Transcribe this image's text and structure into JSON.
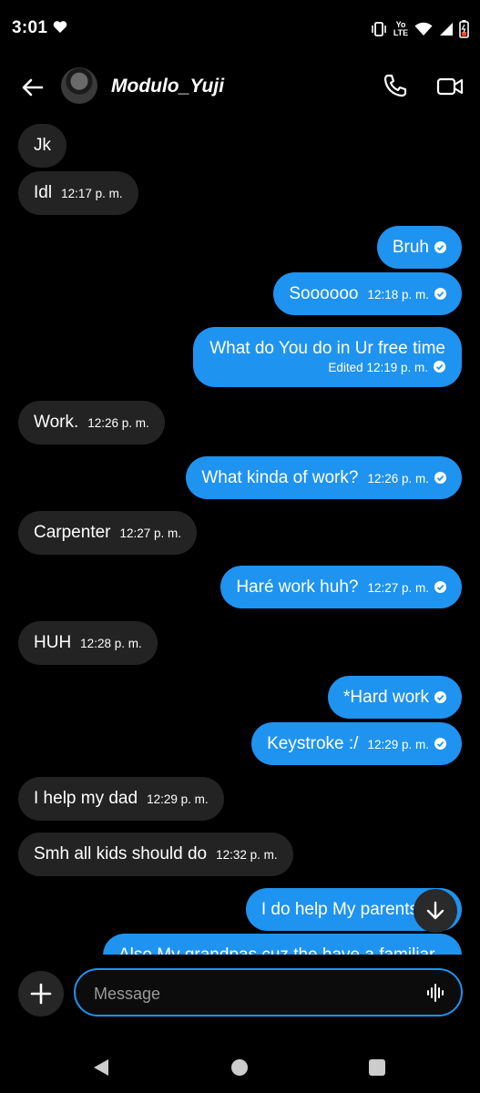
{
  "status_bar": {
    "time": "3:01",
    "network": "LTE",
    "carrier_badge": "Yo"
  },
  "header": {
    "contact_name": "Modulo_Yuji"
  },
  "messages": [
    {
      "side": "in",
      "text": "Jk",
      "time": "",
      "edited": false
    },
    {
      "side": "in",
      "text": "Idl",
      "time": "12:17 p. m.",
      "edited": false
    },
    {
      "side": "out",
      "text": "Bruh",
      "time": "",
      "edited": false
    },
    {
      "side": "out",
      "text": "Soooooo",
      "time": "12:18 p. m.",
      "edited": false
    },
    {
      "side": "out",
      "text": "What do You do in Ur free time",
      "time": "12:19 p. m.",
      "edited": true,
      "edited_label": "Edited"
    },
    {
      "side": "in",
      "text": "Work.",
      "time": "12:26 p. m.",
      "edited": false
    },
    {
      "side": "out",
      "text": "What kinda of work?",
      "time": "12:26 p. m.",
      "edited": false
    },
    {
      "side": "in",
      "text": "Carpenter",
      "time": "12:27 p. m.",
      "edited": false
    },
    {
      "side": "out",
      "text": "Haré work huh?",
      "time": "12:27 p. m.",
      "edited": false
    },
    {
      "side": "in",
      "text": "HUH",
      "time": "12:28 p. m.",
      "edited": false
    },
    {
      "side": "out",
      "text": "*Hard work",
      "time": "",
      "edited": false
    },
    {
      "side": "out",
      "text": "Keystroke :/",
      "time": "12:29 p. m.",
      "edited": false
    },
    {
      "side": "in",
      "text": "I help my dad",
      "time": "12:29 p. m.",
      "edited": false
    },
    {
      "side": "in",
      "text": "Smh all kids should do",
      "time": "12:32 p. m.",
      "edited": false
    },
    {
      "side": "out",
      "text": "I do help My parents",
      "time": "",
      "edited": false
    },
    {
      "side": "out",
      "text": "Also My grandpas cuz the have a familiar",
      "time": "",
      "edited": false
    }
  ],
  "composer": {
    "placeholder": "Message"
  },
  "colors": {
    "outgoing": "#1f93f0",
    "incoming": "#232323",
    "background": "#000000"
  },
  "icons": {
    "back": "arrow-left-icon",
    "call": "phone-icon",
    "video": "video-camera-icon",
    "scroll": "arrow-down-icon",
    "add": "plus-icon",
    "voice": "waveform-icon",
    "nav_back": "triangle-back-icon",
    "nav_home": "circle-home-icon",
    "nav_recents": "square-recents-icon"
  }
}
